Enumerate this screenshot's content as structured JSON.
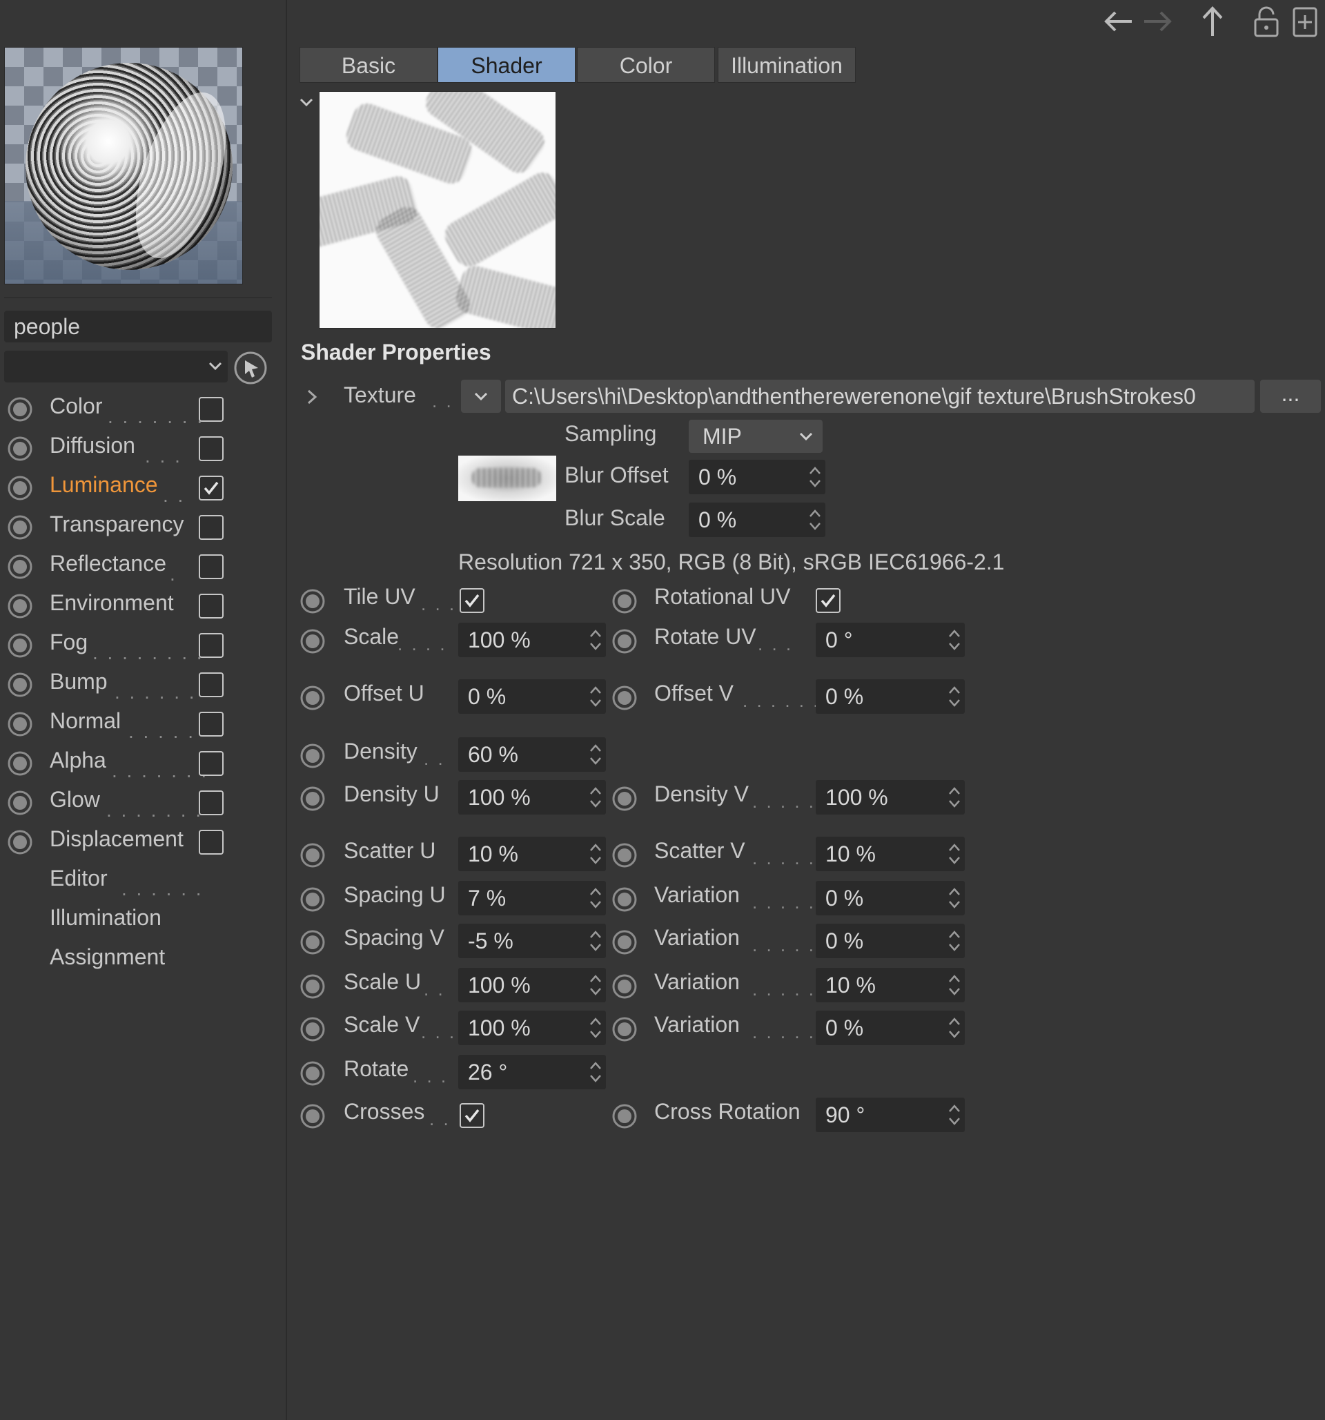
{
  "left_panel": {
    "material_name": "people",
    "channels": [
      {
        "label": "Color",
        "dots": ". . . . . . .",
        "checked": false,
        "active": false
      },
      {
        "label": "Diffusion",
        "dots": ". . .",
        "checked": false,
        "active": false
      },
      {
        "label": "Luminance",
        "dots": ". .",
        "checked": true,
        "active": true
      },
      {
        "label": "Transparency",
        "dots": "",
        "checked": false,
        "active": false
      },
      {
        "label": "Reflectance",
        "dots": ".",
        "checked": false,
        "active": false
      },
      {
        "label": "Environment",
        "dots": "",
        "checked": false,
        "active": false
      },
      {
        "label": "Fog",
        "dots": ". . . . . . . .",
        "checked": false,
        "active": false
      },
      {
        "label": "Bump",
        "dots": ". . . . . .",
        "checked": false,
        "active": false
      },
      {
        "label": "Normal",
        "dots": ". . . . .",
        "checked": false,
        "active": false
      },
      {
        "label": "Alpha",
        "dots": ". . . . . . .",
        "checked": false,
        "active": false
      },
      {
        "label": "Glow",
        "dots": ". . . . . . .",
        "checked": false,
        "active": false
      },
      {
        "label": "Displacement",
        "dots": "",
        "checked": false,
        "active": false
      }
    ],
    "other_items": [
      {
        "label": "Editor",
        "dots": ". . . . . ."
      },
      {
        "label": "Illumination",
        "dots": ""
      },
      {
        "label": "Assignment",
        "dots": ""
      }
    ]
  },
  "tabs": [
    {
      "label": "Basic",
      "active": false
    },
    {
      "label": "Shader",
      "active": true
    },
    {
      "label": "Color",
      "active": false
    },
    {
      "label": "Illumination",
      "active": false
    }
  ],
  "shader": {
    "section_title": "Shader Properties",
    "texture_label": "Texture",
    "texture_dots": ". .",
    "texture_path": "C:\\Users\\hi\\Desktop\\andthentherewerenone\\gif texture\\BrushStrokes0",
    "browse_label": "...",
    "sampling_label": "Sampling",
    "sampling_value": "MIP",
    "blur_offset_label": "Blur Offset",
    "blur_offset_value": "0 %",
    "blur_scale_label": "Blur Scale",
    "blur_scale_value": "0 %",
    "resolution": "Resolution 721 x 350, RGB (8 Bit), sRGB IEC61966-2.1"
  },
  "params": {
    "tile_uv": {
      "label": "Tile UV",
      "dots": ". . .",
      "checked": true
    },
    "rotational_uv": {
      "label": "Rotational UV",
      "checked": true
    },
    "scale": {
      "label": "Scale",
      "dots": ". . . .",
      "value": "100 %"
    },
    "rotate_uv": {
      "label": "Rotate UV",
      "dots": ". . .",
      "value": "0 °"
    },
    "offset_u": {
      "label": "Offset U",
      "value": "0 %"
    },
    "offset_v": {
      "label": "Offset V",
      "dots": ". . . . . .",
      "value": "0 %"
    },
    "density": {
      "label": "Density",
      "dots": ". .",
      "value": "60 %"
    },
    "density_u": {
      "label": "Density U",
      "value": "100 %"
    },
    "density_v": {
      "label": "Density V",
      "dots": ". . . . .",
      "value": "100 %"
    },
    "scatter_u": {
      "label": "Scatter U",
      "value": "10 %"
    },
    "scatter_v": {
      "label": "Scatter V",
      "dots": ". . . . .",
      "value": "10 %"
    },
    "spacing_u": {
      "label": "Spacing U",
      "value": "7 %"
    },
    "variation_1": {
      "label": "Variation",
      "dots": ". . . . .",
      "value": "0 %"
    },
    "spacing_v": {
      "label": "Spacing V",
      "value": "-5 %"
    },
    "variation_2": {
      "label": "Variation",
      "dots": ". . . . .",
      "value": "0 %"
    },
    "scale_u": {
      "label": "Scale U",
      "dots": ". .",
      "value": "100 %"
    },
    "variation_3": {
      "label": "Variation",
      "dots": ". . . . .",
      "value": "10 %"
    },
    "scale_v": {
      "label": "Scale V",
      "dots": ". . .",
      "value": "100 %"
    },
    "variation_4": {
      "label": "Variation",
      "dots": ". . . . .",
      "value": "0 %"
    },
    "rotate": {
      "label": "Rotate",
      "dots": ". . .",
      "value": "26 °"
    },
    "crosses": {
      "label": "Crosses",
      "dots": ". .",
      "checked": true
    },
    "cross_rotation": {
      "label": "Cross Rotation",
      "value": "90 °"
    }
  },
  "colors": {
    "background": "#363636",
    "active_tab": "#84a4cd",
    "active_channel": "#f0963a",
    "field_dark": "#2a2a2a",
    "field_mid": "#4a4a4a"
  }
}
